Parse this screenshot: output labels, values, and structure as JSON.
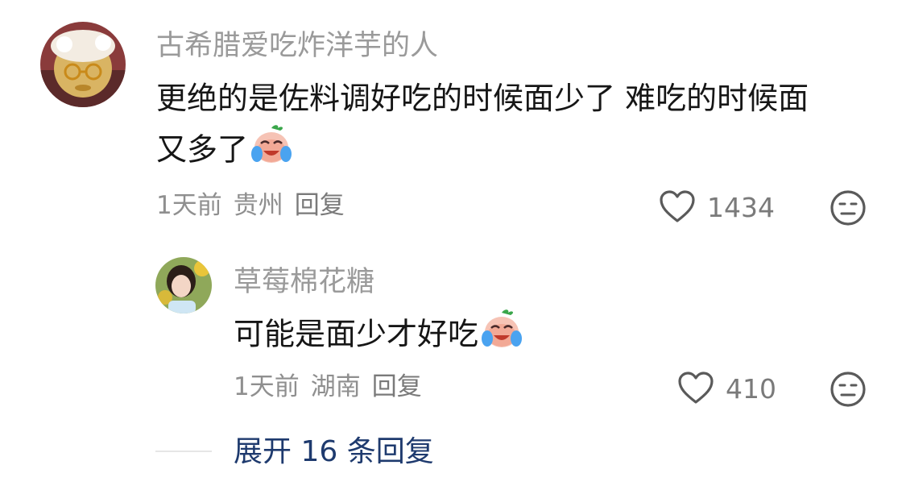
{
  "comments": [
    {
      "username": "古希腊爱吃炸洋芋的人",
      "text_line1": "更绝的是佐料调好吃的时候面少了 难吃的时候面",
      "text_line2": "又多了",
      "emoji": "laugh-cry-emoji",
      "time": "1天前",
      "location": "贵州",
      "reply_label": "回复",
      "likes": "1434"
    }
  ],
  "replies": [
    {
      "username": "草莓棉花糖",
      "text": "可能是面少才好吃",
      "emoji": "laugh-cry-emoji",
      "time": "1天前",
      "location": "湖南",
      "reply_label": "回复",
      "likes": "410"
    }
  ],
  "expand": {
    "label": "展开 16 条回复"
  },
  "colors": {
    "username": "#9a9a9a",
    "meta": "#8f8f8f",
    "expand": "#1e3a6e",
    "text": "#161616"
  }
}
